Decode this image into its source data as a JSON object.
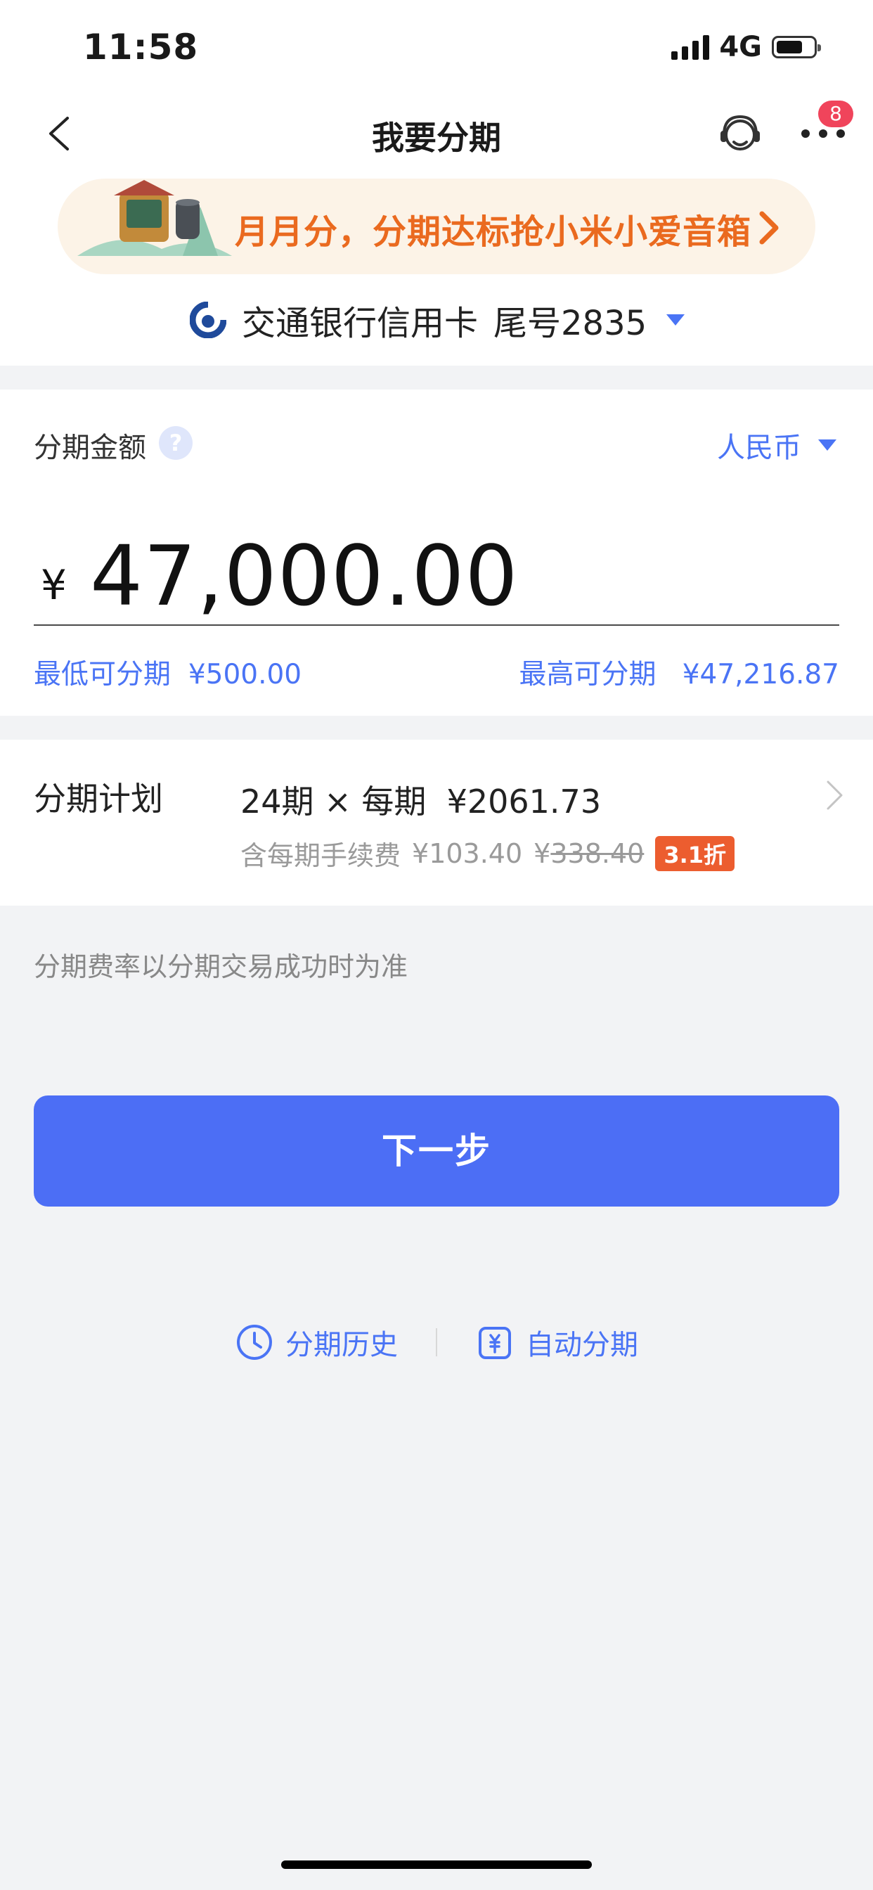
{
  "status": {
    "time": "11:58",
    "network": "4G"
  },
  "nav": {
    "title": "我要分期",
    "badge_count": "8"
  },
  "banner": {
    "text": "月月分，分期达标抢小米小爱音箱"
  },
  "card": {
    "bank": "交通银行信用卡",
    "tail": "尾号2835"
  },
  "amount_section": {
    "label": "分期金额",
    "help": "?",
    "currency": "人民币",
    "symbol": "¥",
    "value": "47,000.00",
    "min_label": "最低可分期",
    "min_value": "¥500.00",
    "max_label": "最高可分期",
    "max_value": "¥47,216.87"
  },
  "plan": {
    "label": "分期计划",
    "periods": "24期",
    "times": "×",
    "per_label": "每期",
    "per_value": "¥2061.73",
    "fee_label": "含每期手续费",
    "fee_value": "¥103.40",
    "orig_symbol": "¥",
    "orig_value": "338.40",
    "discount": "3.1折"
  },
  "note": "分期费率以分期交易成功时为准",
  "next_button": "下一步",
  "links": {
    "history": "分期历史",
    "auto": "自动分期"
  },
  "colors": {
    "accent": "#4c6ef5",
    "banner_text": "#ea6a1f",
    "discount": "#ec5d2f",
    "badge": "#f0445b"
  }
}
